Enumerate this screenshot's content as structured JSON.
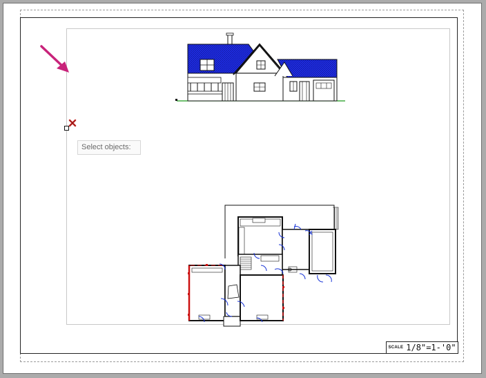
{
  "sheet": {
    "scale_prefix": "SCALE",
    "scale_value": "1/8\"=1-'0\""
  },
  "prompt": {
    "text": "Select objects:"
  },
  "colors": {
    "roof_hatch": "#1f2ee8",
    "ground_line": "#1a9b1a",
    "door_swing": "#1733d6",
    "wall_highlight": "#cc1111",
    "annotation_arrow": "#c8237a",
    "cursor_x": "#d0312d"
  },
  "icons": {
    "cursor": "pickbox-crosshair-icon",
    "arrow": "pointer-arrow-icon"
  }
}
